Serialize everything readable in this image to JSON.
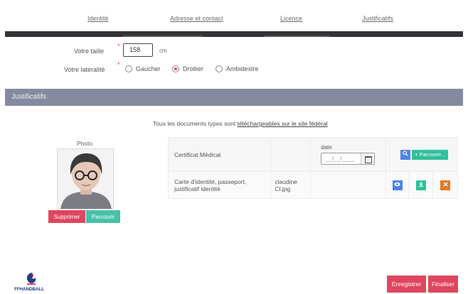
{
  "nav": {
    "tabs": [
      "Identité",
      "Adresse et contact",
      "Licence",
      "Justificatifs"
    ]
  },
  "form": {
    "height_label": "Votre taille",
    "height_value": "158",
    "height_unit": "cm",
    "laterality_label": "Votre latéralité",
    "required_mark": "*",
    "laterality_options": [
      "Gaucher",
      "Droitier",
      "Ambidextre"
    ],
    "laterality_selected": "Droitier"
  },
  "section": {
    "title": "Justificatifs",
    "info_text": "Tous les documents types sont ",
    "info_link": "téléchargeables sur le site fédéral"
  },
  "photo": {
    "label": "Photo",
    "delete_label": "Supprimer",
    "browse_label": "Parcourir"
  },
  "documents": {
    "rows": [
      {
        "name": "Certificat Médical",
        "file": "",
        "date_label": "date",
        "date_placeholder": "__/__/____",
        "browse_label": "Parcourir..."
      },
      {
        "name": "Carte d'identité, passeport, justificatif identité",
        "file": "claudine Cl.jpg"
      }
    ]
  },
  "footer": {
    "logo_text": "FFHANDBALL",
    "save_label": "Enregistrer",
    "finish_label": "Finaliser"
  },
  "colors": {
    "accent_red": "#e0465e",
    "teal": "#47c1a8",
    "section_bg": "#868aa0",
    "blue": "#4c82e8",
    "orange": "#e27a22"
  }
}
